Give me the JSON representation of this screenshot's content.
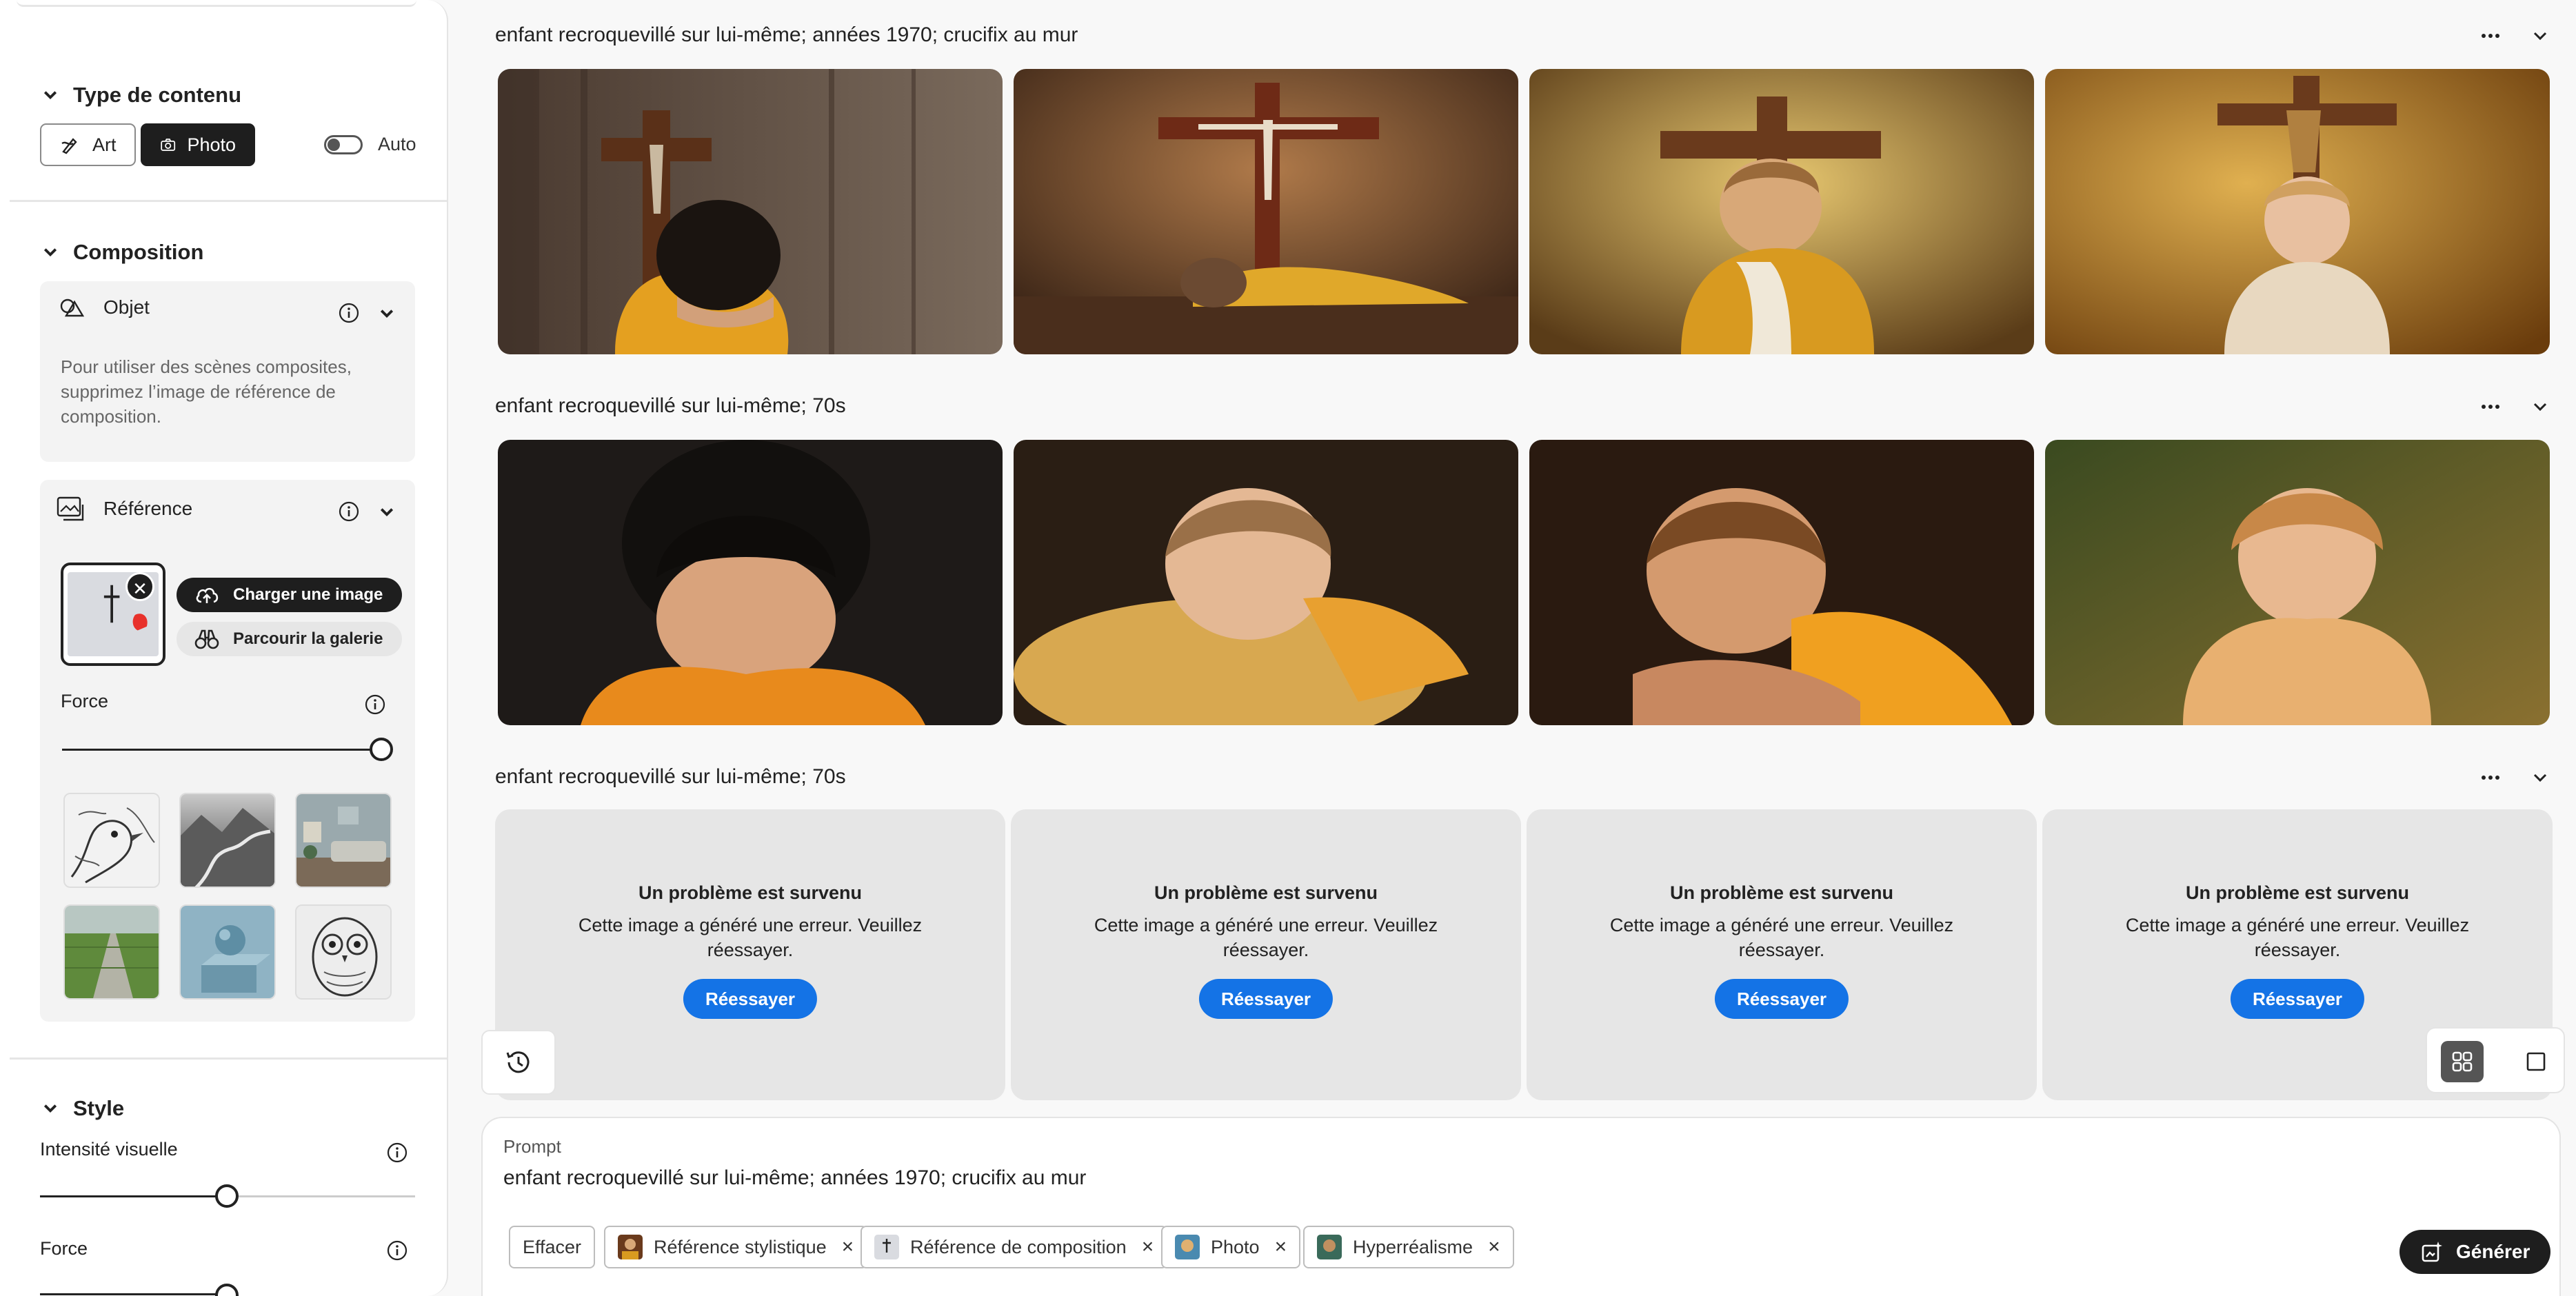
{
  "sidebar": {
    "content_type": {
      "title": "Type de contenu",
      "art_label": "Art",
      "photo_label": "Photo",
      "auto_label": "Auto",
      "active": "Photo",
      "auto_enabled": false
    },
    "composition": {
      "title": "Composition",
      "object": {
        "label": "Objet",
        "note": "Pour utiliser des scènes composites, supprimez l’image de référence de composition."
      },
      "reference": {
        "label": "Référence",
        "upload_label": "Charger une image",
        "browse_label": "Parcourir la galerie",
        "force_label": "Force",
        "force_value": 1.0
      },
      "presets": [
        "bird-sketch-thumbnail",
        "mountain-valley-thumbnail",
        "living-room-thumbnail",
        "green-field-road-thumbnail",
        "sphere-on-cube-thumbnail",
        "owl-sketch-thumbnail"
      ]
    },
    "style": {
      "title": "Style",
      "intensity_label": "Intensité visuelle",
      "intensity_value": 0.5,
      "force_label": "Force"
    }
  },
  "rows": [
    {
      "title": "enfant recroquevillé sur lui-même; années 1970; crucifix au mur",
      "images": [
        "child-crouched-wooden-cross",
        "child-lying-under-crucifix",
        "child-holding-blanket-cross",
        "child-sitting-under-crucifix"
      ]
    },
    {
      "title": "enfant recroquevillé sur lui-même; 70s",
      "images": [
        "child-head-on-arms-dark",
        "child-resting-on-pillow",
        "child-smiling-arms-crossed",
        "child-outdoor-sunlight"
      ]
    },
    {
      "title": "enfant recroquevillé sur lui-même; 70s",
      "errors": [
        {
          "title": "Un problème est survenu",
          "message": "Cette image a généré une erreur. Veuillez réessayer.",
          "retry": "Réessayer"
        },
        {
          "title": "Un problème est survenu",
          "message": "Cette image a généré une erreur. Veuillez réessayer.",
          "retry": "Réessayer"
        },
        {
          "title": "Un problème est survenu",
          "message": "Cette image a généré une erreur. Veuillez réessayer.",
          "retry": "Réessayer"
        },
        {
          "title": "Un problème est survenu",
          "message": "Cette image a généré une erreur. Veuillez réessayer.",
          "retry": "Réessayer"
        }
      ]
    }
  ],
  "prompt": {
    "label": "Prompt",
    "text": "enfant recroquevillé sur lui-même; années 1970; crucifix au mur",
    "clear_label": "Effacer",
    "chips": [
      "Référence stylistique",
      "Référence de composition",
      "Photo",
      "Hyperréalisme"
    ],
    "generate_label": "Générer"
  },
  "colors": {
    "accent_blue": "#1473e6",
    "dark_button": "#1e1e1e",
    "error_tile": "#e6e6e6"
  }
}
